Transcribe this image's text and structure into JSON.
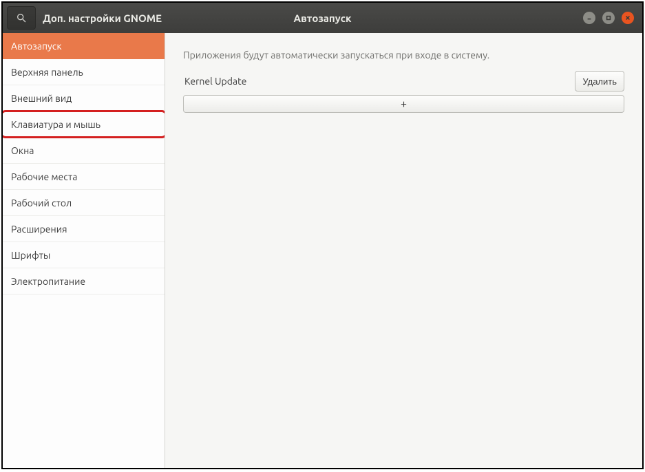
{
  "titlebar": {
    "app_title": "Доп. настройки GNOME",
    "page_title": "Автозапуск"
  },
  "sidebar": {
    "items": [
      {
        "label": "Автозапуск",
        "active": true,
        "highlighted": false
      },
      {
        "label": "Верхняя панель",
        "active": false,
        "highlighted": false
      },
      {
        "label": "Внешний вид",
        "active": false,
        "highlighted": false
      },
      {
        "label": "Клавиатура и мышь",
        "active": false,
        "highlighted": true
      },
      {
        "label": "Окна",
        "active": false,
        "highlighted": false
      },
      {
        "label": "Рабочие места",
        "active": false,
        "highlighted": false
      },
      {
        "label": "Рабочий стол",
        "active": false,
        "highlighted": false
      },
      {
        "label": "Расширения",
        "active": false,
        "highlighted": false
      },
      {
        "label": "Шрифты",
        "active": false,
        "highlighted": false
      },
      {
        "label": "Электропитание",
        "active": false,
        "highlighted": false
      }
    ]
  },
  "content": {
    "description": "Приложения будут автоматически запускаться при входе в систему.",
    "apps": [
      {
        "name": "Kernel Update",
        "delete_label": "Удалить"
      }
    ],
    "add_label": "+"
  }
}
